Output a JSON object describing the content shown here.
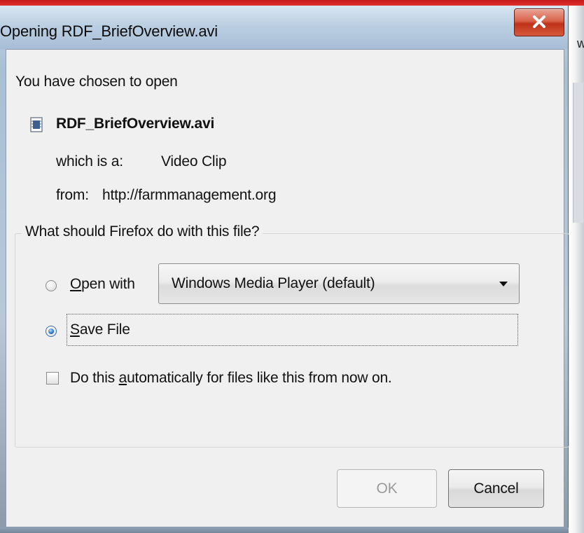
{
  "window": {
    "title": "Opening RDF_BriefOverview.avi",
    "close_glyph": "close-icon"
  },
  "background_peek_text": "w",
  "intro_text": "You have chosen to open",
  "file": {
    "name": "RDF_BriefOverview.avi",
    "icon": "video-file-icon",
    "type_label": "which is a:",
    "type_value": "Video Clip",
    "from_label": "from:",
    "from_value": "http://farmmanagement.org"
  },
  "action_group": {
    "title": "What should Firefox do with this file?",
    "open_with": {
      "label_accesskey": "O",
      "label_rest": "pen with",
      "selected": false
    },
    "application": {
      "selected_value": "Windows Media Player (default)"
    },
    "save_file": {
      "label_accesskey": "S",
      "label_rest": "ave File",
      "selected": true
    },
    "auto": {
      "label_before": "Do this ",
      "label_accesskey": "a",
      "label_after": "utomatically for files like this from now on.",
      "checked": false
    }
  },
  "buttons": {
    "ok": "OK",
    "cancel": "Cancel",
    "ok_enabled": false
  },
  "colors": {
    "accent": "#2a6fc2",
    "close_button": "#c0311a",
    "title_bar": "#bcd0e3",
    "top_strip": "#e23030"
  }
}
